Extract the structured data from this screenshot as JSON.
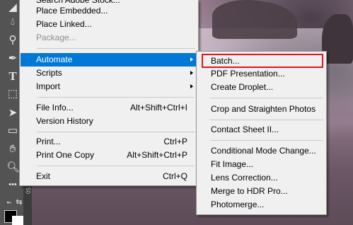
{
  "main_menu": {
    "items": [
      {
        "label": "Search Adobe Stock...",
        "shortcut": "",
        "disabled": false
      },
      {
        "label": "Place Embedded...",
        "shortcut": "",
        "disabled": false
      },
      {
        "label": "Place Linked...",
        "shortcut": "",
        "disabled": false
      },
      {
        "label": "Package...",
        "shortcut": "",
        "disabled": true
      },
      {
        "label": "Automate",
        "shortcut": "",
        "disabled": false
      },
      {
        "label": "Scripts",
        "shortcut": "",
        "disabled": false
      },
      {
        "label": "Import",
        "shortcut": "",
        "disabled": false
      },
      {
        "label": "File Info...",
        "shortcut": "Alt+Shift+Ctrl+I",
        "disabled": false
      },
      {
        "label": "Version History",
        "shortcut": "",
        "disabled": false
      },
      {
        "label": "Print...",
        "shortcut": "Ctrl+P",
        "disabled": false
      },
      {
        "label": "Print One Copy",
        "shortcut": "Alt+Shift+Ctrl+P",
        "disabled": false
      },
      {
        "label": "Exit",
        "shortcut": "Ctrl+Q",
        "disabled": false
      }
    ]
  },
  "automate_submenu": {
    "items": [
      {
        "label": "Batch..."
      },
      {
        "label": "PDF Presentation..."
      },
      {
        "label": "Create Droplet..."
      },
      {
        "label": "Crop and Straighten Photos"
      },
      {
        "label": "Contact Sheet II..."
      },
      {
        "label": "Conditional Mode Change..."
      },
      {
        "label": "Fit Image..."
      },
      {
        "label": "Lens Correction..."
      },
      {
        "label": "Merge to HDR Pro..."
      },
      {
        "label": "Photomerge..."
      }
    ]
  },
  "ruler": {
    "number": "50"
  },
  "colors": {
    "menu_highlight": "#0078d7",
    "annotation_box": "#e01818",
    "menu_bg": "#f0f0f0"
  },
  "toolbar_icons": [
    "blur-drop-icon",
    "dodge-icon",
    "pen-icon",
    "type-icon",
    "path-select-icon",
    "move-arrow-icon",
    "rectangle-icon",
    "hand-icon",
    "zoom-icon",
    "more-tools-icon",
    "swap-colors-icon"
  ]
}
